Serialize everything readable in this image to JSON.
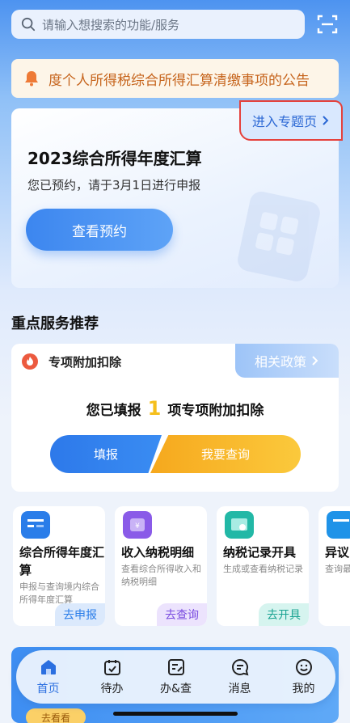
{
  "search": {
    "placeholder": "请输入想搜索的功能/服务",
    "icon": "search-icon"
  },
  "scan_icon": "scan-icon",
  "notice": {
    "text": "度个人所得税综合所得汇算清缴事项的公告",
    "icon": "bell-icon"
  },
  "feature_card": {
    "topic_link": "进入专题页",
    "title": "2023综合所得年度汇算",
    "subtitle": "您已预约，请于3月1日进行申报",
    "button": "查看预约"
  },
  "section_title": "重点服务推荐",
  "deduction_card": {
    "label": "专项附加扣除",
    "policy_link": "相关政策",
    "filled_prefix": "您已填报",
    "filled_count": "1",
    "filled_suffix": "项专项附加扣除",
    "fill_button": "填报",
    "query_button": "我要查询"
  },
  "tiles": [
    {
      "title": "综合所得年度汇算",
      "desc": "申报与查询境内综合所得年度汇算",
      "action": "去申报",
      "color": "#2a7de9"
    },
    {
      "title": "收入纳税明细",
      "desc": "查看综合所得收入和纳税明细",
      "action": "去查询",
      "color": "#8a5be8"
    },
    {
      "title": "纳税记录开具",
      "desc": "生成或查看纳税记录",
      "action": "去开具",
      "color": "#22b8a6"
    },
    {
      "title": "异议申",
      "desc": "查询最结果",
      "action": "",
      "color": "#1f93e8"
    }
  ],
  "tabs": [
    {
      "label": "首页",
      "icon": "home-icon",
      "active": true
    },
    {
      "label": "待办",
      "icon": "calendar-check-icon",
      "active": false
    },
    {
      "label": "办&查",
      "icon": "document-edit-icon",
      "active": false
    },
    {
      "label": "消息",
      "icon": "message-icon",
      "active": false
    },
    {
      "label": "我的",
      "icon": "smile-icon",
      "active": false
    }
  ],
  "peek_button": "去看看"
}
